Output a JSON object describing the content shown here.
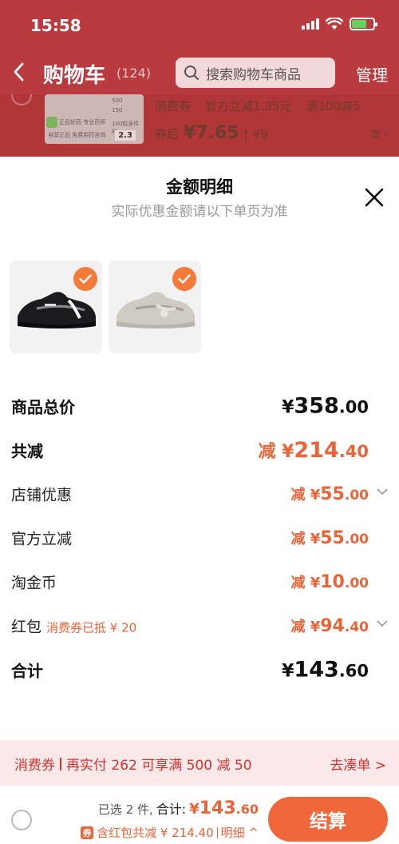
{
  "status_bar": {
    "time": "15:58"
  },
  "header": {
    "title": "购物车",
    "count": "(124)",
    "search_placeholder": "搜索购物车商品",
    "manage_label": "管理"
  },
  "background_item": {
    "coupon_label": "消费券",
    "official_discount": "官方立减1.35元",
    "threshold": "满100减5",
    "after_coupon_label": "券后",
    "after_coupon_price": "¥7.65",
    "original_price": "¥9",
    "thumb_texts": [
      "500",
      "150",
      "正品好药 专业药师",
      "自营正品 免费用药咨询",
      "100粒多件时",
      "2.3"
    ]
  },
  "sheet": {
    "title": "金额明细",
    "subtitle": "实际优惠金额请以下单页为准",
    "products": [
      {
        "name": "black-sneaker",
        "selected": true
      },
      {
        "name": "beige-sneaker",
        "selected": true
      }
    ],
    "rows": [
      {
        "label": "商品总价",
        "prefix": "¥",
        "int": "358",
        "dec": ".00",
        "style": "total"
      },
      {
        "label": "共减",
        "prefix": "减 ¥",
        "int": "214",
        "dec": ".40",
        "style": "discount-total"
      },
      {
        "label": "店铺优惠",
        "prefix": "减 ¥",
        "int": "55",
        "dec": ".00",
        "style": "discount",
        "expandable": true
      },
      {
        "label": "官方立减",
        "prefix": "减 ¥",
        "int": "55",
        "dec": ".00",
        "style": "discount"
      },
      {
        "label": "淘金币",
        "prefix": "减 ¥",
        "int": "10",
        "dec": ".00",
        "style": "discount"
      },
      {
        "label": "红包",
        "tag": "消费券已抵 ¥ 20",
        "prefix": "减 ¥",
        "int": "94",
        "dec": ".40",
        "style": "discount",
        "expandable": true
      },
      {
        "label": "合计",
        "prefix": "¥",
        "int": "143",
        "dec": ".60",
        "style": "total"
      }
    ]
  },
  "coupon_banner": {
    "tag": "消费券",
    "message": "再实付 262 可享满 500 减 50",
    "action": "去凑单 >"
  },
  "checkout": {
    "selected_text": "已选 2 件,",
    "total_label": "合计:",
    "price_prefix": "¥",
    "price_int": "143",
    "price_dec": ".60",
    "redpacket_icon": "券",
    "savings_text": "含红包共减 ¥ 214.40",
    "detail_link": "明细 ^",
    "pay_button": "结算"
  },
  "colors": {
    "accent": "#e8653a",
    "header_bg": "#b93a3f",
    "pay_button": "#f0673a",
    "banner_bg": "#fbe9ea"
  }
}
